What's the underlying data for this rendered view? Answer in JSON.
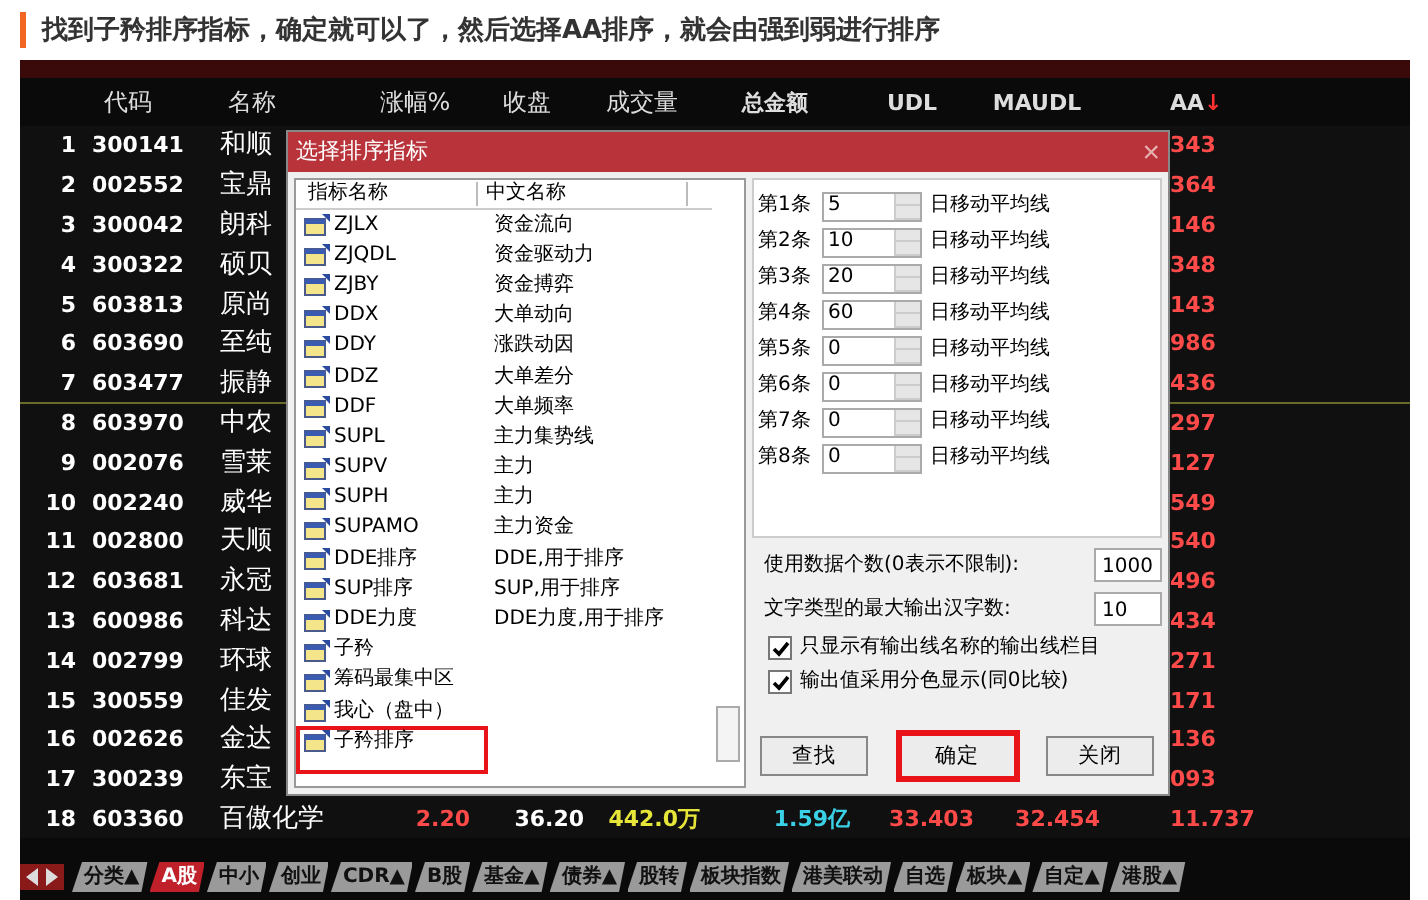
{
  "caption": "找到子矜排序指标，确定就可以了，然后选择AA排序，就会由强到弱进行排序",
  "table": {
    "columns": [
      {
        "label": "代码"
      },
      {
        "label": "名称"
      },
      {
        "label": "涨幅%"
      },
      {
        "label": "收盘"
      },
      {
        "label": "成交量"
      },
      {
        "label": "总金额"
      },
      {
        "label": "UDL"
      },
      {
        "label": "MAUDL"
      },
      {
        "label": "AA",
        "sort": "↓"
      }
    ],
    "rows": [
      {
        "num": "1",
        "code": "300141",
        "name": "和顺",
        "aa": "343",
        "divider": false
      },
      {
        "num": "2",
        "code": "002552",
        "name": "宝鼎",
        "aa": "364",
        "divider": false
      },
      {
        "num": "3",
        "code": "300042",
        "name": "朗科",
        "aa": "146",
        "divider": false
      },
      {
        "num": "4",
        "code": "300322",
        "name": "硕贝",
        "aa": "348",
        "divider": false
      },
      {
        "num": "5",
        "code": "603813",
        "name": "原尚",
        "aa": "143",
        "divider": false
      },
      {
        "num": "6",
        "code": "603690",
        "name": "至纯",
        "aa": "986",
        "divider": false
      },
      {
        "num": "7",
        "code": "603477",
        "name": "振静",
        "aa": "436",
        "divider": true
      },
      {
        "num": "8",
        "code": "603970",
        "name": "中农",
        "aa": "297",
        "divider": false
      },
      {
        "num": "9",
        "code": "002076",
        "name": "雪莱",
        "aa": "127",
        "divider": false
      },
      {
        "num": "10",
        "code": "002240",
        "name": "威华",
        "aa": "549",
        "divider": false
      },
      {
        "num": "11",
        "code": "002800",
        "name": "天顺",
        "aa": "540",
        "divider": false
      },
      {
        "num": "12",
        "code": "603681",
        "name": "永冠",
        "aa": "496",
        "divider": false
      },
      {
        "num": "13",
        "code": "600986",
        "name": "科达",
        "aa": "434",
        "divider": false
      },
      {
        "num": "14",
        "code": "002799",
        "name": "环球",
        "aa": "271",
        "divider": false
      },
      {
        "num": "15",
        "code": "300559",
        "name": "佳发",
        "aa": "171",
        "divider": false
      },
      {
        "num": "16",
        "code": "002626",
        "name": "金达",
        "aa": "136",
        "divider": false
      },
      {
        "num": "17",
        "code": "300239",
        "name": "东宝",
        "aa": "093",
        "divider": false
      },
      {
        "num": "18",
        "code": "603360",
        "name": "百傲化学",
        "chg": "2.20",
        "close": "36.20",
        "vol": "442.0万",
        "amount": "1.59亿",
        "udl": "33.403",
        "maudl": "32.454",
        "aa": "11.737",
        "divider": false
      }
    ]
  },
  "dialog": {
    "title": "选择排序指标",
    "close": "×",
    "list_columns": [
      "指标名称",
      "中文名称"
    ],
    "items": [
      {
        "name": "ZJLX",
        "cn": "资金流向",
        "highlighted": false
      },
      {
        "name": "ZJQDL",
        "cn": "资金驱动力",
        "highlighted": false
      },
      {
        "name": "ZJBY",
        "cn": "资金搏弈",
        "highlighted": false
      },
      {
        "name": "DDX",
        "cn": "大单动向",
        "highlighted": false
      },
      {
        "name": "DDY",
        "cn": "涨跌动因",
        "highlighted": false
      },
      {
        "name": "DDZ",
        "cn": "大单差分",
        "highlighted": false
      },
      {
        "name": "DDF",
        "cn": "大单频率",
        "highlighted": false
      },
      {
        "name": "SUPL",
        "cn": "主力集势线",
        "highlighted": false
      },
      {
        "name": "SUPV",
        "cn": "主力",
        "highlighted": false
      },
      {
        "name": "SUPH",
        "cn": "主力",
        "highlighted": false
      },
      {
        "name": "SUPAMO",
        "cn": "主力资金",
        "highlighted": false
      },
      {
        "name": "DDE排序",
        "cn": "DDE,用于排序",
        "highlighted": false
      },
      {
        "name": "SUP排序",
        "cn": "SUP,用于排序",
        "highlighted": false
      },
      {
        "name": "DDE力度",
        "cn": "DDE力度,用于排序",
        "highlighted": false
      },
      {
        "name": "子矜",
        "highlighted": false
      },
      {
        "name": "筹码最集中区",
        "highlighted": false
      },
      {
        "name": "我心（盘中）",
        "highlighted": false
      },
      {
        "name": "子矜排序",
        "highlighted": true
      }
    ],
    "params": [
      {
        "label": "第1条",
        "value": "5",
        "unit": "日移动平均线"
      },
      {
        "label": "第2条",
        "value": "10",
        "unit": "日移动平均线"
      },
      {
        "label": "第3条",
        "value": "20",
        "unit": "日移动平均线"
      },
      {
        "label": "第4条",
        "value": "60",
        "unit": "日移动平均线"
      },
      {
        "label": "第5条",
        "value": "0",
        "unit": "日移动平均线"
      },
      {
        "label": "第6条",
        "value": "0",
        "unit": "日移动平均线"
      },
      {
        "label": "第7条",
        "value": "0",
        "unit": "日移动平均线"
      },
      {
        "label": "第8条",
        "value": "0",
        "unit": "日移动平均线"
      }
    ],
    "fields": [
      {
        "label": "使用数据个数(0表示不限制):",
        "value": "1000"
      },
      {
        "label": "文字类型的最大输出汉字数:",
        "value": "10"
      }
    ],
    "checkboxes": [
      {
        "label": "只显示有输出线名称的输出线栏目",
        "checked": true
      },
      {
        "label": "输出值采用分色显示(同0比较)",
        "checked": true
      }
    ],
    "buttons": [
      {
        "label": "查找",
        "highlighted": false
      },
      {
        "label": "确定",
        "highlighted": true
      },
      {
        "label": "关闭",
        "highlighted": false
      }
    ]
  },
  "tabs": [
    {
      "label": "分类▲",
      "selected": false
    },
    {
      "label": "A股",
      "selected": true
    },
    {
      "label": "中小",
      "selected": false
    },
    {
      "label": "创业",
      "selected": false
    },
    {
      "label": "CDR▲",
      "selected": false
    },
    {
      "label": "B股",
      "selected": false
    },
    {
      "label": "基金▲",
      "selected": false
    },
    {
      "label": "债券▲",
      "selected": false
    },
    {
      "label": "股转",
      "selected": false
    },
    {
      "label": "板块指数",
      "selected": false
    },
    {
      "label": "港美联动",
      "selected": false
    },
    {
      "label": "自选",
      "selected": false
    },
    {
      "label": "板块▲",
      "selected": false
    },
    {
      "label": "自定▲",
      "selected": false
    },
    {
      "label": "港股▲",
      "selected": false
    }
  ]
}
